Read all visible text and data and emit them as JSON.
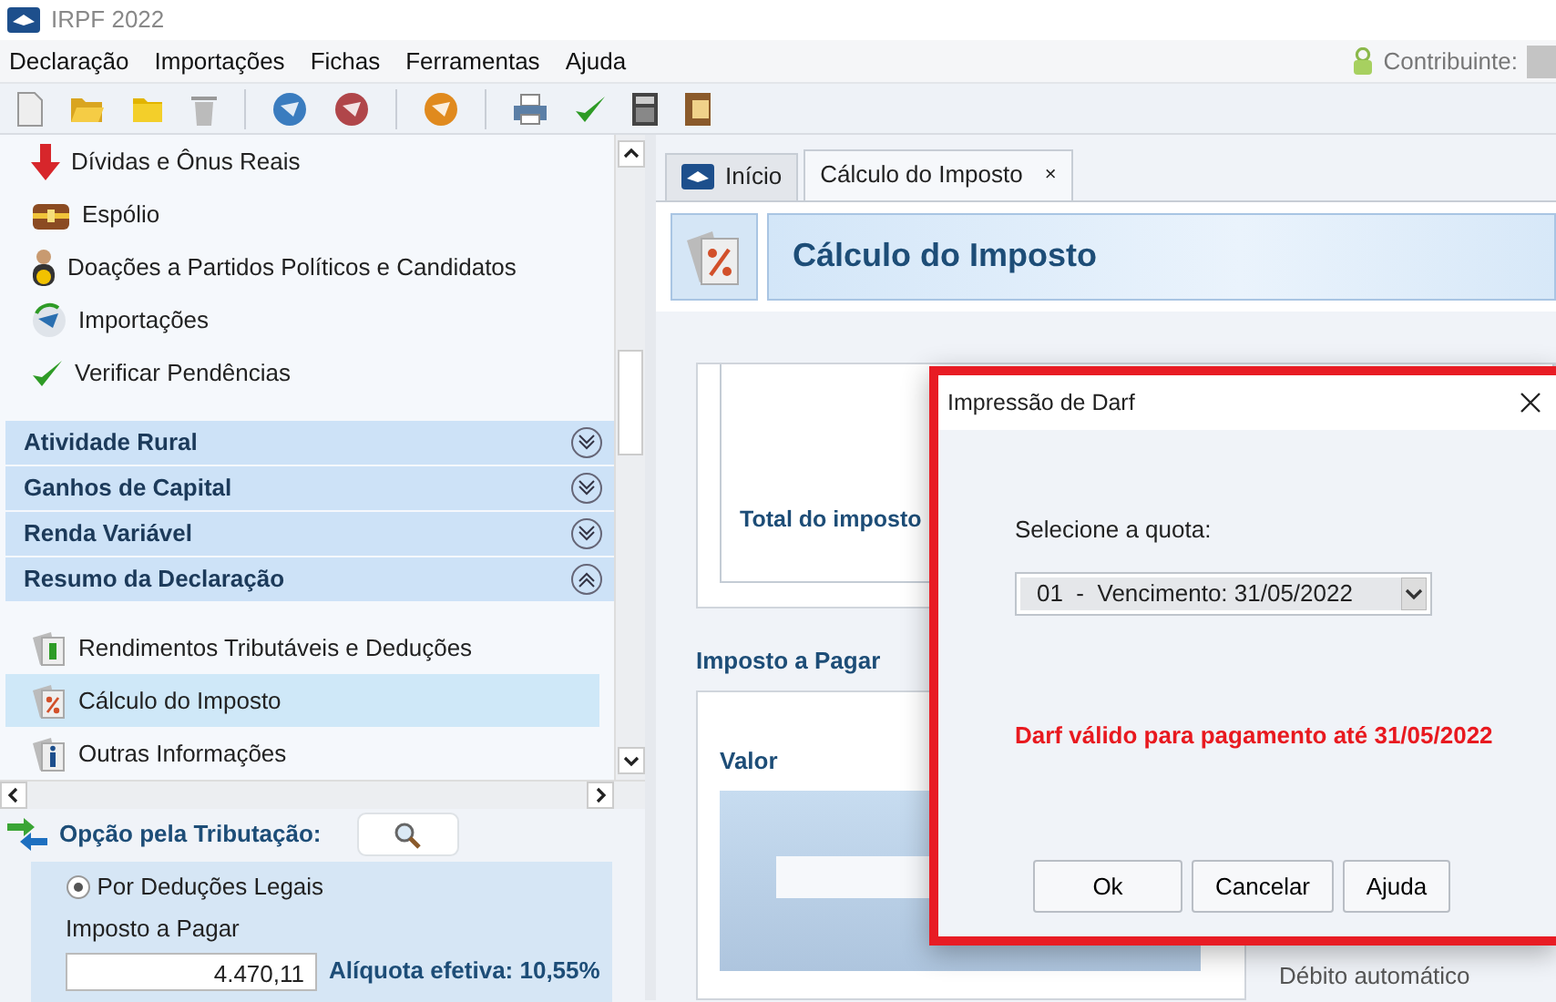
{
  "window": {
    "title": "IRPF 2022"
  },
  "menu": [
    {
      "label": "Declaração"
    },
    {
      "label": "Importações"
    },
    {
      "label": "Fichas"
    },
    {
      "label": "Ferramentas"
    },
    {
      "label": "Ajuda"
    }
  ],
  "contribuinte": {
    "label": "Contribuinte:"
  },
  "sidebar": {
    "items": [
      {
        "label": "Dívidas e Ônus Reais"
      },
      {
        "label": "Espólio"
      },
      {
        "label": "Doações a Partidos Políticos e Candidatos"
      },
      {
        "label": "Importações"
      },
      {
        "label": "Verificar Pendências"
      }
    ],
    "sections": [
      {
        "title": "Atividade Rural",
        "expanded": false
      },
      {
        "title": "Ganhos de Capital",
        "expanded": false
      },
      {
        "title": "Renda Variável",
        "expanded": false
      },
      {
        "title": "Resumo da Declaração",
        "expanded": true,
        "children": [
          {
            "label": "Rendimentos Tributáveis e Deduções",
            "selected": false
          },
          {
            "label": "Cálculo do Imposto",
            "selected": true
          },
          {
            "label": "Outras Informações",
            "selected": false
          }
        ]
      }
    ]
  },
  "opcao": {
    "label": "Opção pela Tributação:",
    "radio": {
      "label": "Por Deduções Legais",
      "checked": true
    },
    "field_label": "Imposto a Pagar",
    "value": "4.470,11",
    "aliquota": "Alíquota efetiva: 10,55%"
  },
  "tabs": [
    {
      "label": "Início",
      "selected": false
    },
    {
      "label": "Cálculo do Imposto",
      "selected": true,
      "close": "×"
    }
  ],
  "header": {
    "title": "Cálculo do Imposto"
  },
  "content": {
    "total_label": "Total do imposto",
    "section_title": "Imposto a Pagar",
    "valor_label": "Valor",
    "debito_label": "Débito automático"
  },
  "dialog": {
    "title": "Impressão de Darf",
    "prompt": "Selecione a quota:",
    "select_value": "01  -  Vencimento: 31/05/2022",
    "warning": "Darf válido para pagamento até 31/05/2022",
    "buttons": [
      "Ok",
      "Cancelar",
      "Ajuda"
    ]
  }
}
